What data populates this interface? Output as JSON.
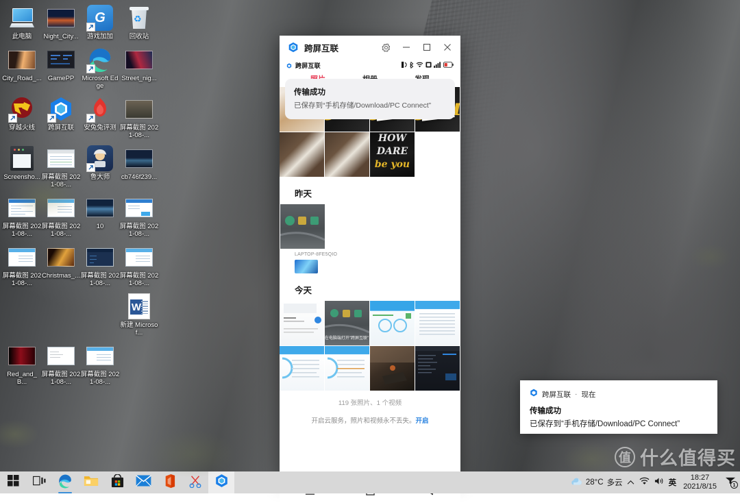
{
  "desktop": {
    "icons": [
      {
        "label": "此电脑",
        "art": "pc",
        "shortcut": false
      },
      {
        "label": "Night_City...",
        "art": "photo-night",
        "shortcut": false
      },
      {
        "label": "游戏加加",
        "art": "tile-gpp",
        "shortcut": true
      },
      {
        "label": "回收站",
        "art": "bin",
        "shortcut": false
      },
      {
        "label": "City_Road_...",
        "art": "photo-city",
        "shortcut": false
      },
      {
        "label": "GamePP",
        "art": "gamepp",
        "shortcut": false
      },
      {
        "label": "Microsoft Edge",
        "art": "edge",
        "shortcut": true
      },
      {
        "label": "Street_nig...",
        "art": "photo-street",
        "shortcut": false
      },
      {
        "label": "穿越火线",
        "art": "tile-cf",
        "shortcut": true
      },
      {
        "label": "跨屏互联",
        "art": "kpl",
        "shortcut": true
      },
      {
        "label": "安兔兔评测",
        "art": "tile-fire",
        "shortcut": true
      },
      {
        "label": "屏幕截图 2021-08-...",
        "art": "photo-shot1",
        "shortcut": false
      },
      {
        "label": "Screensho...",
        "art": "screenshot-tool",
        "shortcut": false
      },
      {
        "label": "屏幕截图 2021-08-...",
        "art": "ss-grey",
        "shortcut": false
      },
      {
        "label": "鲁大师",
        "art": "tile-lu",
        "shortcut": true
      },
      {
        "label": "cb746f239...",
        "art": "photo-lake",
        "shortcut": false
      },
      {
        "label": "屏幕截图 2021-08-...",
        "art": "ss-blue",
        "shortcut": false
      },
      {
        "label": "屏幕截图 2021-08-...",
        "art": "ss-lblue",
        "shortcut": false
      },
      {
        "label": "10",
        "art": "photo-10",
        "shortcut": false
      },
      {
        "label": "屏幕截图 2021-08-...",
        "art": "ss-blue2",
        "shortcut": false
      },
      {
        "label": "屏幕截图 2021-08-...",
        "art": "ss-lblue2",
        "shortcut": false
      },
      {
        "label": "Christmas_...",
        "art": "photo-xmas",
        "shortcut": false
      },
      {
        "label": "屏幕截图 2021-08-...",
        "art": "ss-dark",
        "shortcut": false
      },
      {
        "label": "屏幕截图 2021-08-...",
        "art": "ss-lblue3",
        "shortcut": false
      },
      {
        "label": "新建 Microsof...",
        "art": "word",
        "shortcut": false
      },
      {
        "label": "Red_and_B...",
        "art": "photo-redblk",
        "shortcut": false
      },
      {
        "label": "屏幕截图 2021-08-...",
        "art": "ss-grey2",
        "shortcut": false
      },
      {
        "label": "屏幕截图 2021-08-...",
        "art": "ss-lblue4",
        "shortcut": false
      }
    ]
  },
  "phone_window": {
    "title": "跨屏互联",
    "titlebar_buttons": {
      "settings": "settings-gear",
      "minimize": "minimize",
      "maximize": "maximize",
      "close": "close"
    },
    "status_bar": {
      "carrier_label": "跨屏互联",
      "icons": [
        "nfc-icon",
        "bluetooth-icon",
        "wifi-icon",
        "sim-icon",
        "signal-icon",
        "battery-low-icon"
      ]
    },
    "toast": {
      "title": "传输成功",
      "message": "已保存到“手机存储/Download/PC Connect”"
    },
    "gallery": {
      "tabs": [
        {
          "label": "照片",
          "active": true
        },
        {
          "label": "相册",
          "active": false
        },
        {
          "label": "发现",
          "active": false
        }
      ],
      "sections": [
        {
          "heading": "",
          "rows": [
            [
              "p-box1",
              "p-dark-y",
              "p-card",
              "p-card"
            ],
            [
              "p-tags",
              "p-tags",
              "p-tee"
            ]
          ]
        },
        {
          "heading": "昨天",
          "device_name": "LAPTOP-8FE5QIO",
          "rows": [
            [
              "p-pcscr"
            ]
          ],
          "device_thumb": true
        },
        {
          "heading": "今天",
          "rows": [
            [
              "p-doc",
              "p-laptop-thumb",
              "p-win-blue",
              "p-win-list"
            ],
            [
              "p-win-list",
              "p-win-list",
              "p-game",
              "p-term"
            ]
          ]
        }
      ],
      "footer": {
        "count": "119 张照片、1 个视频",
        "cloud_text": "开启云服务，照片和视频永不丢失。",
        "cloud_action": "开启"
      }
    },
    "navbar": [
      "menu-icon",
      "home-square-icon",
      "back-triangle-icon"
    ]
  },
  "windows_toast": {
    "app_name": "跨屏互联",
    "separator": "·",
    "time": "现在",
    "title": "传输成功",
    "body": "已保存到“手机存储/Download/PC Connect”"
  },
  "taskbar": {
    "items": [
      {
        "name": "start-button",
        "icon": "windows-logo-icon",
        "active": false,
        "running": false
      },
      {
        "name": "task-view-button",
        "icon": "task-view-icon",
        "active": false,
        "running": false
      },
      {
        "name": "edge-button",
        "icon": "edge-icon",
        "active": false,
        "running": true
      },
      {
        "name": "file-explorer-button",
        "icon": "folder-icon",
        "active": false,
        "running": false
      },
      {
        "name": "microsoft-store-button",
        "icon": "store-bag-icon",
        "active": false,
        "running": false
      },
      {
        "name": "mail-button",
        "icon": "mail-envelope-icon",
        "active": false,
        "running": false
      },
      {
        "name": "office-button",
        "icon": "office-icon",
        "active": false,
        "running": false
      },
      {
        "name": "snip-sketch-button",
        "icon": "scissors-icon",
        "active": false,
        "running": false
      },
      {
        "name": "multiscreen-button",
        "icon": "kuapingholian-icon",
        "active": true,
        "running": false
      }
    ],
    "tray": {
      "weather_temp": "28°C",
      "weather_desc": "多云",
      "weather_icon": "cloud-icon",
      "overflow_icon": "chevron-up-icon",
      "network_icon": "wifi-icon",
      "volume_icon": "speaker-icon",
      "language": "英",
      "clock_time": "18:27",
      "clock_date": "2021/8/15",
      "action_center_icon": "action-center-icon",
      "action_center_badge": "1"
    }
  },
  "watermark": {
    "badge": "值",
    "text": "什么值得买"
  },
  "colors": {
    "accent_blue": "#2f86e0",
    "tab_active_red": "#e8415a",
    "taskbar_bg": "#d8d8d8",
    "toast_bg": "#f1f1f3",
    "battery_red": "#e03a35"
  }
}
